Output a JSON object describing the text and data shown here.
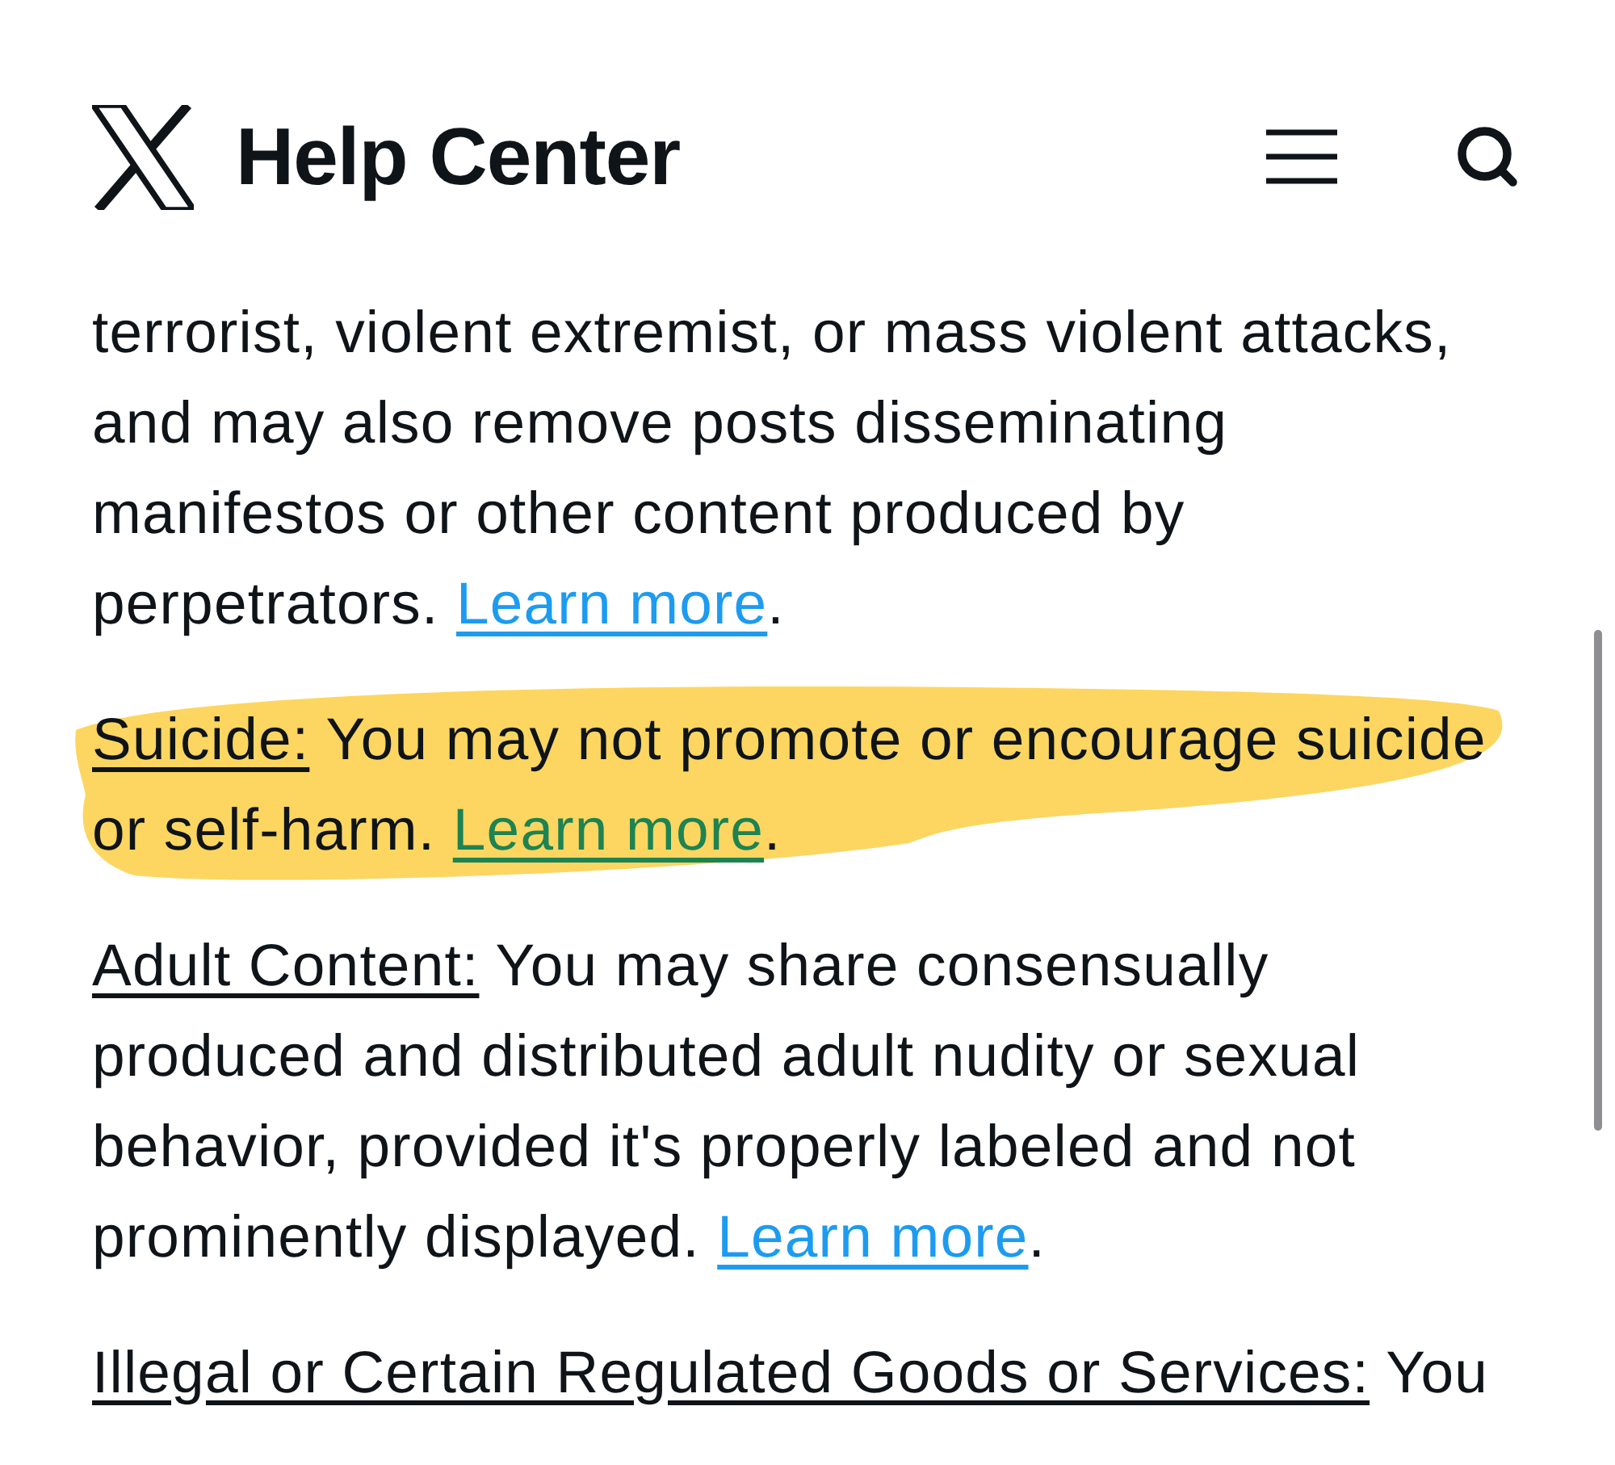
{
  "header": {
    "title": "Help Center"
  },
  "paragraphs": [
    {
      "text": "terrorist, violent extremist, or mass violent attacks, and may also remove posts disseminating manifestos or other content produced by perpetrators. ",
      "link": "Learn more",
      "end": ".",
      "highlighted": false
    },
    {
      "term": "Suicide:",
      "text": " You may not promote or encourage suicide or self-harm. ",
      "link": "Learn more",
      "end": ".",
      "highlighted": true
    },
    {
      "term": "Adult Content:",
      "text": " You may share consensually produced and distributed adult nudity or sexual behavior, provided it's properly labeled and not prominently displayed. ",
      "link": "Learn more",
      "end": ".",
      "highlighted": false
    },
    {
      "term": "Illegal or Certain Regulated Goods or Services:",
      "text": " You",
      "highlighted": false
    }
  ]
}
